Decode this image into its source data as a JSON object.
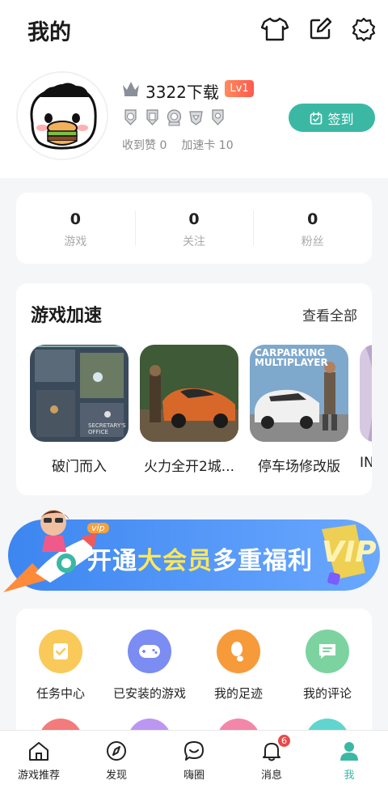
{
  "header": {
    "title": "我的",
    "icons": [
      "tshirt-icon",
      "edit-icon",
      "settings-icon"
    ]
  },
  "profile": {
    "username": "3322下载",
    "level": "Lv1",
    "likes_label": "收到赞 0",
    "boost_label": "加速卡 10",
    "signin_label": "签到",
    "medals": [
      "medal-1-icon",
      "medal-2-icon",
      "medal-3-icon",
      "medal-4-icon",
      "medal-5-icon"
    ]
  },
  "stats": [
    {
      "value": "0",
      "label": "游戏"
    },
    {
      "value": "0",
      "label": "关注"
    },
    {
      "value": "0",
      "label": "粉丝"
    }
  ],
  "games_section": {
    "title": "游戏加速",
    "see_all": "查看全部",
    "games": [
      {
        "name": "破门而入",
        "thumb_text": "SECRETARY'S OFFICE"
      },
      {
        "name": "火力全开2城..."
      },
      {
        "name": "停车场修改版",
        "thumb_text": "CARPARKING MULTIPLAYER"
      },
      {
        "name": "IN"
      }
    ]
  },
  "vip_banner": {
    "text_part1": "开通",
    "text_highlight": "大会员",
    "text_part2": "多重福利",
    "vip_label": "VIP",
    "small_tag": "vip"
  },
  "menu": [
    {
      "label": "任务中心",
      "icon": "task-icon",
      "color": "#f9c95a"
    },
    {
      "label": "已安装的游戏",
      "icon": "gamepad-icon",
      "color": "#7b8cf2"
    },
    {
      "label": "我的足迹",
      "icon": "footprint-icon",
      "color": "#f79a3a"
    },
    {
      "label": "我的评论",
      "icon": "comment-icon",
      "color": "#7dd3a0"
    }
  ],
  "menu_row2_colors": [
    "#f26d6d",
    "#b48cf0",
    "#f27aa0",
    "#4fd0c8"
  ],
  "bottom_nav": [
    {
      "label": "游戏推荐",
      "icon": "home-icon"
    },
    {
      "label": "发现",
      "icon": "compass-icon"
    },
    {
      "label": "嗨圈",
      "icon": "chat-bubble-icon"
    },
    {
      "label": "消息",
      "icon": "bell-icon",
      "badge": "6"
    },
    {
      "label": "我",
      "icon": "user-icon",
      "active": true
    }
  ],
  "colors": {
    "accent": "#3bb8a4",
    "badge_red": "#e84a4a"
  }
}
